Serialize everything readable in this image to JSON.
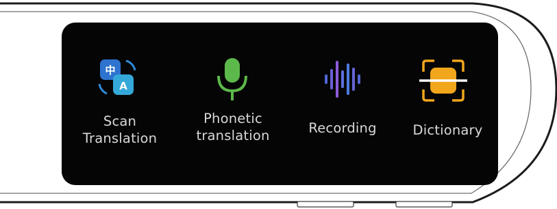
{
  "apps": [
    {
      "label_line1": "Scan",
      "label_line2": "Translation",
      "icon": "scan-translation-icon"
    },
    {
      "label_line1": "Phonetic",
      "label_line2": "translation",
      "icon": "microphone-icon"
    },
    {
      "label_line1": "Recording",
      "label_line2": "",
      "icon": "recording-waveform-icon"
    },
    {
      "label_line1": "Dictionary",
      "label_line2": "",
      "icon": "dictionary-scan-icon"
    }
  ],
  "colors": {
    "screen_bg": "#050505",
    "label": "#d9d9d9",
    "scan_blue": "#2f7fd6",
    "scan_teal": "#35a6d8",
    "mic_green": "#5ab84a",
    "wave_blue": "#5a6fd8",
    "dict_orange": "#f2a61c"
  }
}
